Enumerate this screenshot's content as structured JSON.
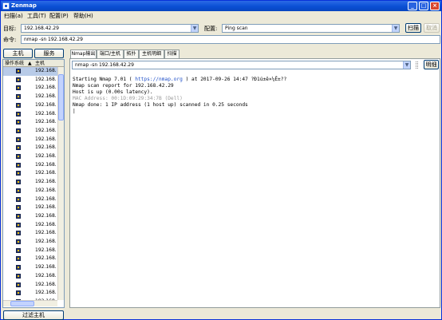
{
  "window": {
    "title": "Zenmap"
  },
  "menu": [
    "扫描(a)",
    "工具(T)",
    "配置(P)",
    "帮助(H)"
  ],
  "target": {
    "label": "目标:",
    "value": "192.168.42.29"
  },
  "profile": {
    "label": "配置:",
    "value": "Ping scan"
  },
  "scan_button": "扫描",
  "cancel_button": "取消",
  "command": {
    "label": "命令:",
    "value": "nmap -sn 192.168.42.29"
  },
  "side": {
    "hosts_button": "主机",
    "services_button": "服务",
    "col_os": "操作系统",
    "col_host": "主机",
    "hosts": [
      "192.168.",
      "192.168.",
      "192.168.",
      "192.168.",
      "192.168.",
      "192.168.",
      "192.168.",
      "192.168.",
      "192.168.",
      "192.168.",
      "192.168.",
      "192.168.",
      "192.168.",
      "192.168.",
      "192.168.",
      "192.168.",
      "192.168.",
      "192.168.",
      "192.168.",
      "192.168.",
      "192.168.",
      "192.168.",
      "192.168.",
      "192.168.",
      "192.168.",
      "192.168.",
      "192.168.",
      "192.168."
    ],
    "filter_button": "过滤主机"
  },
  "tabs": [
    "Nmap输出",
    "端口/主机",
    "拓扑",
    "主机明细",
    "扫描"
  ],
  "output_select": "nmap -sn 192.168.42.29",
  "details_button": "明细",
  "output": {
    "line1a": "Starting Nmap 7.01 ( ",
    "line1link": "https://nmap.org",
    "line1b": " ) at 2017-09-26 14:47 ?Ð1ú±ê×¼Ê±??",
    "line2": "Nmap scan report for 192.168.42.29",
    "line3": "Host is up (0.00s latency).",
    "line4": "MAC Address: 00:1D:09:29:34:7B (Dell)",
    "line5": "Nmap done: 1 IP address (1 host up) scanned in 0.25 seconds"
  }
}
